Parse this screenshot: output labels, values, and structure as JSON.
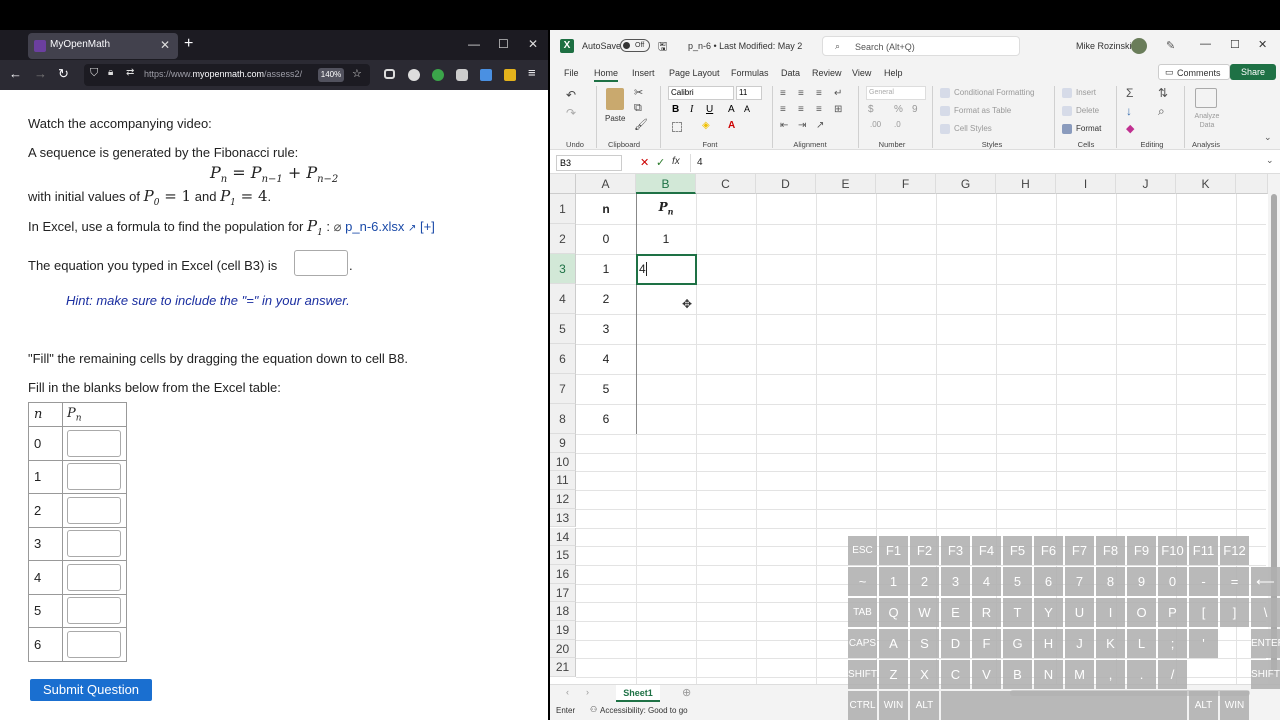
{
  "browser": {
    "tab_title": "MyOpenMath",
    "url_prefix": "https://www.",
    "url_domain": "myopenmath.com",
    "url_suffix": "/assess2/",
    "zoom": "140%"
  },
  "page": {
    "watch_text": "Watch the accompanying video:",
    "sequence_text": "A sequence is generated by the Fibonacci rule:",
    "formula_lhs": "P",
    "formula_lhs_sub": "n",
    "formula_eq": " = ",
    "formula_t1": "P",
    "formula_t1_sub": "n−1",
    "formula_plus": " + ",
    "formula_t2": "P",
    "formula_t2_sub": "n−2",
    "initial_prefix": "with initial values of",
    "p0": "P",
    "p0_sub": "0",
    "p0_val": " = 1",
    "and_text": "and",
    "p1": "P",
    "p1_sub": "1",
    "p1_val": " = 4",
    "period": ".",
    "excel_prefix": "In Excel, use a formula to find the population for",
    "excel_p1": "P",
    "excel_p1_sub": "1",
    "colon": ":",
    "file_link": "p_n-6.xlsx",
    "plus_link": "[+]",
    "equation_text": "The equation you typed in Excel (cell B3) is",
    "hint": "Hint: make sure to include the \"=\" in your answer.",
    "fill_text": "\"Fill\" the remaining cells by dragging the equation down to cell B8.",
    "blanks_text": "Fill in the blanks below from the Excel table:",
    "table_head_n": "n",
    "table_head_p": "P",
    "table_head_p_sub": "n",
    "table_rows": [
      "0",
      "1",
      "2",
      "3",
      "4",
      "5",
      "6"
    ],
    "submit": "Submit Question"
  },
  "excel": {
    "autosave": "AutoSave",
    "toggle": "Off",
    "filename": "p_n-6 • Last Modified: May 2",
    "search": "Search (Alt+Q)",
    "user": "Mike Rozinski",
    "comments": "Comments",
    "share": "Share",
    "menu": [
      "File",
      "Home",
      "Insert",
      "Page Layout",
      "Formulas",
      "Data",
      "Review",
      "View",
      "Help"
    ],
    "font_name": "Calibri",
    "font_size": "11",
    "number_format": "General",
    "styles_items": [
      "Conditional Formatting",
      "Format as Table",
      "Cell Styles"
    ],
    "cells_items": [
      "Insert",
      "Delete",
      "Format"
    ],
    "paste": "Paste",
    "analyze": "Analyze Data",
    "groups": [
      "Undo",
      "Clipboard",
      "Font",
      "Alignment",
      "Number",
      "Styles",
      "Cells",
      "Editing",
      "Analysis"
    ],
    "namebox": "B3",
    "formula": "4",
    "fx": "fx",
    "columns": [
      "A",
      "B",
      "C",
      "D",
      "E",
      "F",
      "G",
      "H",
      "I",
      "J",
      "K"
    ],
    "rows": [
      "1",
      "2",
      "3",
      "4",
      "5",
      "6",
      "7",
      "8",
      "9",
      "10",
      "11",
      "12",
      "13",
      "14",
      "15",
      "16",
      "17",
      "18",
      "19",
      "20",
      "21"
    ],
    "header_n": "n",
    "header_p": "P",
    "header_p_sub": "n",
    "col_a": [
      "0",
      "1",
      "2",
      "3",
      "4",
      "5",
      "6"
    ],
    "b2": "1",
    "b3": "4",
    "sheet": "Sheet1",
    "status_mode": "Enter",
    "status_access": "Accessibility: Good to go"
  },
  "keyboard": {
    "row1": [
      "ESC",
      "F1",
      "F2",
      "F3",
      "F4",
      "F5",
      "F6",
      "F7",
      "F8",
      "F9",
      "F10",
      "F11",
      "F12"
    ],
    "row2": [
      "~",
      "1",
      "2",
      "3",
      "4",
      "5",
      "6",
      "7",
      "8",
      "9",
      "0",
      "-",
      "=",
      "⟵"
    ],
    "row3": [
      "TAB",
      "Q",
      "W",
      "E",
      "R",
      "T",
      "Y",
      "U",
      "I",
      "O",
      "P",
      "[",
      "]",
      "\\"
    ],
    "row4": [
      "CAPS",
      "A",
      "S",
      "D",
      "F",
      "G",
      "H",
      "J",
      "K",
      "L",
      ";",
      "'",
      "ENTER"
    ],
    "row5": [
      "SHIFT",
      "Z",
      "X",
      "C",
      "V",
      "B",
      "N",
      "M",
      ",",
      ".",
      "/",
      "SHIFT"
    ],
    "row6": [
      "CTRL",
      "WIN",
      "ALT",
      "ALT",
      "WIN"
    ]
  }
}
